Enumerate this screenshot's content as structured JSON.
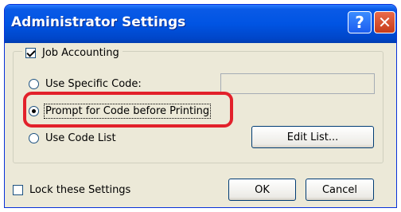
{
  "window": {
    "title": "Administrator Settings",
    "help_icon": "?",
    "close_icon": "✕"
  },
  "group": {
    "checkbox_label": "Job Accounting",
    "checkbox_checked": true
  },
  "options": [
    {
      "label": "Use Specific Code:",
      "selected": false
    },
    {
      "label": "Prompt for Code before Printing",
      "selected": true
    },
    {
      "label": "Use Code List",
      "selected": false
    }
  ],
  "specific_code_value": "",
  "edit_list_label": "Edit List...",
  "lock_label": "Lock these Settings",
  "lock_checked": false,
  "ok_label": "OK",
  "cancel_label": "Cancel",
  "colors": {
    "title_bar": "#0054e3",
    "dialog_bg": "#ece9d8",
    "highlight": "#e2212b"
  }
}
